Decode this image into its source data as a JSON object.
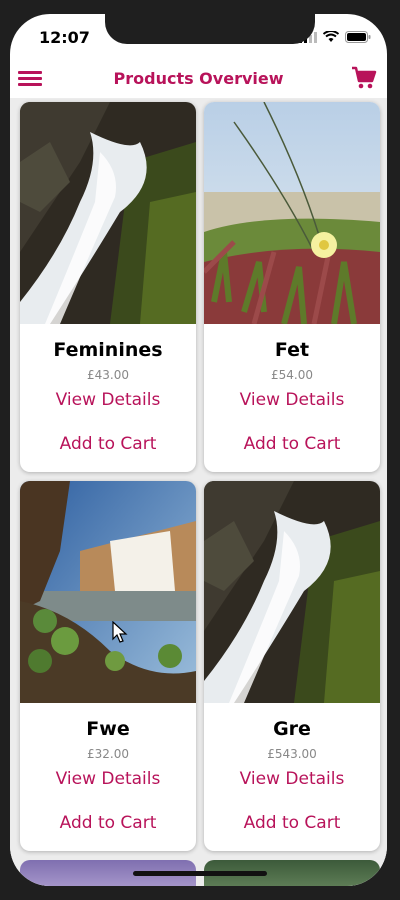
{
  "status_bar": {
    "time": "12:07"
  },
  "header": {
    "title": "Products Overview",
    "menu_icon": "hamburger-menu-icon",
    "cart_icon": "shopping-cart-icon"
  },
  "accent_color": "#b8135a",
  "products": [
    {
      "title": "Feminines",
      "price": "£43.00",
      "details_label": "View Details",
      "cart_label": "Add to Cart",
      "image": "waterfall-closeup"
    },
    {
      "title": "Fet",
      "price": "£54.00",
      "details_label": "View Details",
      "cart_label": "Add to Cart",
      "image": "yellow-flower-field"
    },
    {
      "title": "Fwe",
      "price": "£32.00",
      "details_label": "View Details",
      "cart_label": "Add to Cart",
      "image": "waterfall-landscape"
    },
    {
      "title": "Gre",
      "price": "£543.00",
      "details_label": "View Details",
      "cart_label": "Add to Cart",
      "image": "waterfall-closeup"
    }
  ]
}
